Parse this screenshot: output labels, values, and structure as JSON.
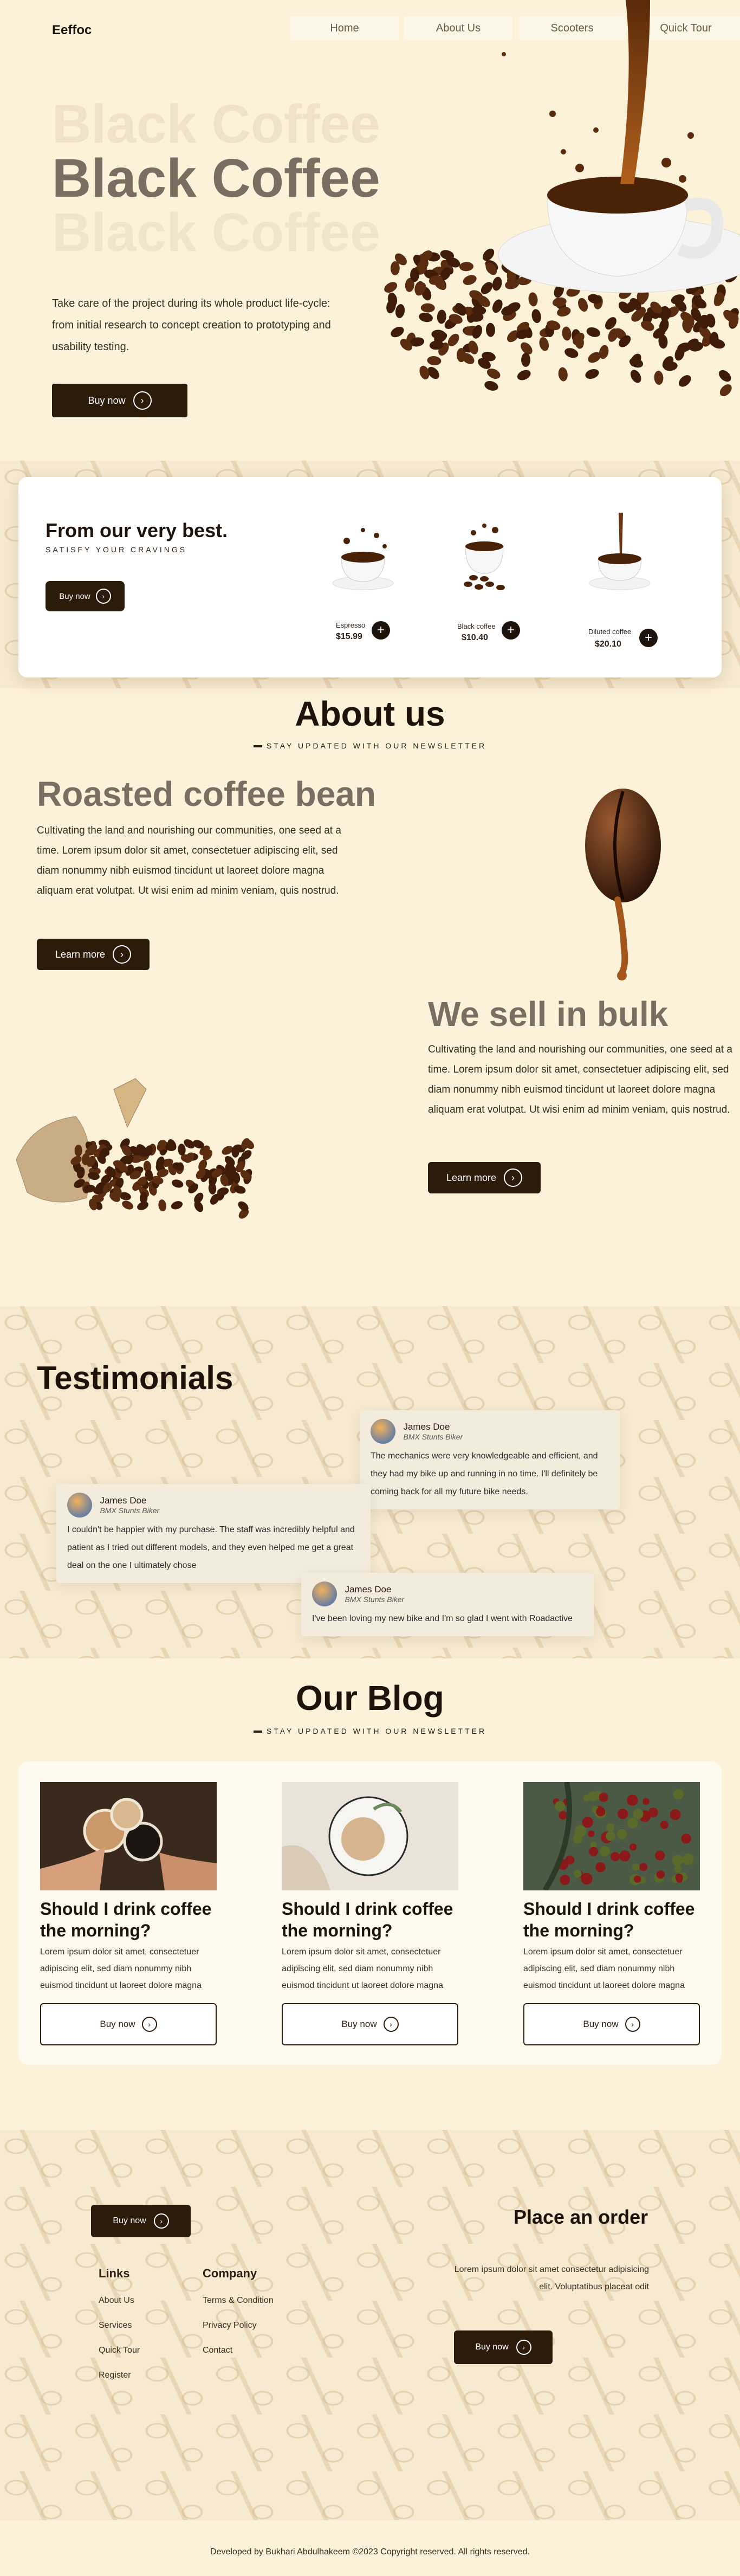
{
  "brand": "Eeffoc",
  "nav": [
    "Home",
    "About Us",
    "Scooters",
    "Quick Tour"
  ],
  "hero": {
    "title": "Black Coffee",
    "description": "Take care of the project during its whole product life-cycle: from initial research to concept creation to prototyping and usability testing.",
    "cta": "Buy now"
  },
  "best": {
    "title": "From our very best.",
    "subtitle": "SATISFY YOUR CRAVINGS",
    "cta": "Buy now",
    "products": [
      {
        "name": "Espresso",
        "price": "$15.99"
      },
      {
        "name": "Black coffee",
        "price": "$10.40"
      },
      {
        "name": "Diluted coffee",
        "price": "$20.10"
      }
    ]
  },
  "about": {
    "title": "About us",
    "subtitle": "STAY UPDATED WITH OUR NEWSLETTER",
    "roasted_title": "Roasted coffee bean",
    "roasted_text": "Cultivating the land and nourishing our communities, one seed at a time. Lorem ipsum dolor sit amet, consectetuer adipiscing elit, sed diam nonummy nibh euismod tincidunt ut laoreet dolore magna aliquam erat volutpat. Ut wisi enim ad minim veniam, quis nostrud.",
    "roasted_cta": "Learn more",
    "bulk_title": "We sell in bulk",
    "bulk_text": "Cultivating the land and nourishing our communities, one seed at a time. Lorem ipsum dolor sit amet, consectetuer adipiscing elit, sed diam nonummy nibh euismod tincidunt ut laoreet dolore magna aliquam erat volutpat. Ut wisi enim ad minim veniam, quis nostrud.",
    "bulk_cta": "Learn more"
  },
  "testimonials": {
    "title": "Testimonials",
    "items": [
      {
        "name": "James Doe",
        "role": "BMX Stunts Biker",
        "text": "The mechanics were very knowledgeable and efficient, and they had my bike up and running in no time. I'll definitely be coming back for all my future bike needs."
      },
      {
        "name": "James Doe",
        "role": "BMX Stunts Biker",
        "text": "I couldn't be happier with my purchase. The staff was incredibly helpful and patient as I tried out different models, and they even helped me get a great deal on the one I ultimately chose"
      },
      {
        "name": "James Doe",
        "role": "BMX Stunts Biker",
        "text": "I've been loving my new bike and I'm so glad I went with Roadactive"
      }
    ]
  },
  "blog": {
    "title": "Our Blog",
    "subtitle": "STAY UPDATED WITH OUR NEWSLETTER",
    "posts": [
      {
        "title": "Should I drink coffee the morning?",
        "text": "Lorem ipsum dolor sit amet, consectetuer adipiscing elit, sed diam nonummy nibh euismod tincidunt ut laoreet dolore magna",
        "cta": "Buy now"
      },
      {
        "title": "Should I drink coffee the morning?",
        "text": "Lorem ipsum dolor sit amet, consectetuer adipiscing elit, sed diam nonummy nibh euismod tincidunt ut laoreet dolore magna",
        "cta": "Buy now"
      },
      {
        "title": "Should I drink coffee the morning?",
        "text": "Lorem ipsum dolor sit amet, consectetuer adipiscing elit, sed diam nonummy nibh euismod tincidunt ut laoreet dolore magna",
        "cta": "Buy now"
      }
    ]
  },
  "footer": {
    "cta": "Buy now",
    "links_title": "Links",
    "links": [
      "About Us",
      "Services",
      "Quick Tour",
      "Register"
    ],
    "company_title": "Company",
    "company": [
      "Terms & Condition",
      "Privacy Policy",
      "Contact"
    ],
    "order_title": "Place an order",
    "order_text": "Lorem ipsum dolor sit amet consectetur adipisicing elit. Voluptatibus placeat odit",
    "order_cta": "Buy now",
    "copyright": "Developed by Bukhari Abdulhakeem ©2023 Copyright reserved. All rights reserved."
  },
  "colors": {
    "cream": "#fbf2d9",
    "dark": "#2b1b0b",
    "muted_title": "#7a6d62"
  },
  "icons": [
    "arrow-right-icon",
    "plus-icon"
  ]
}
